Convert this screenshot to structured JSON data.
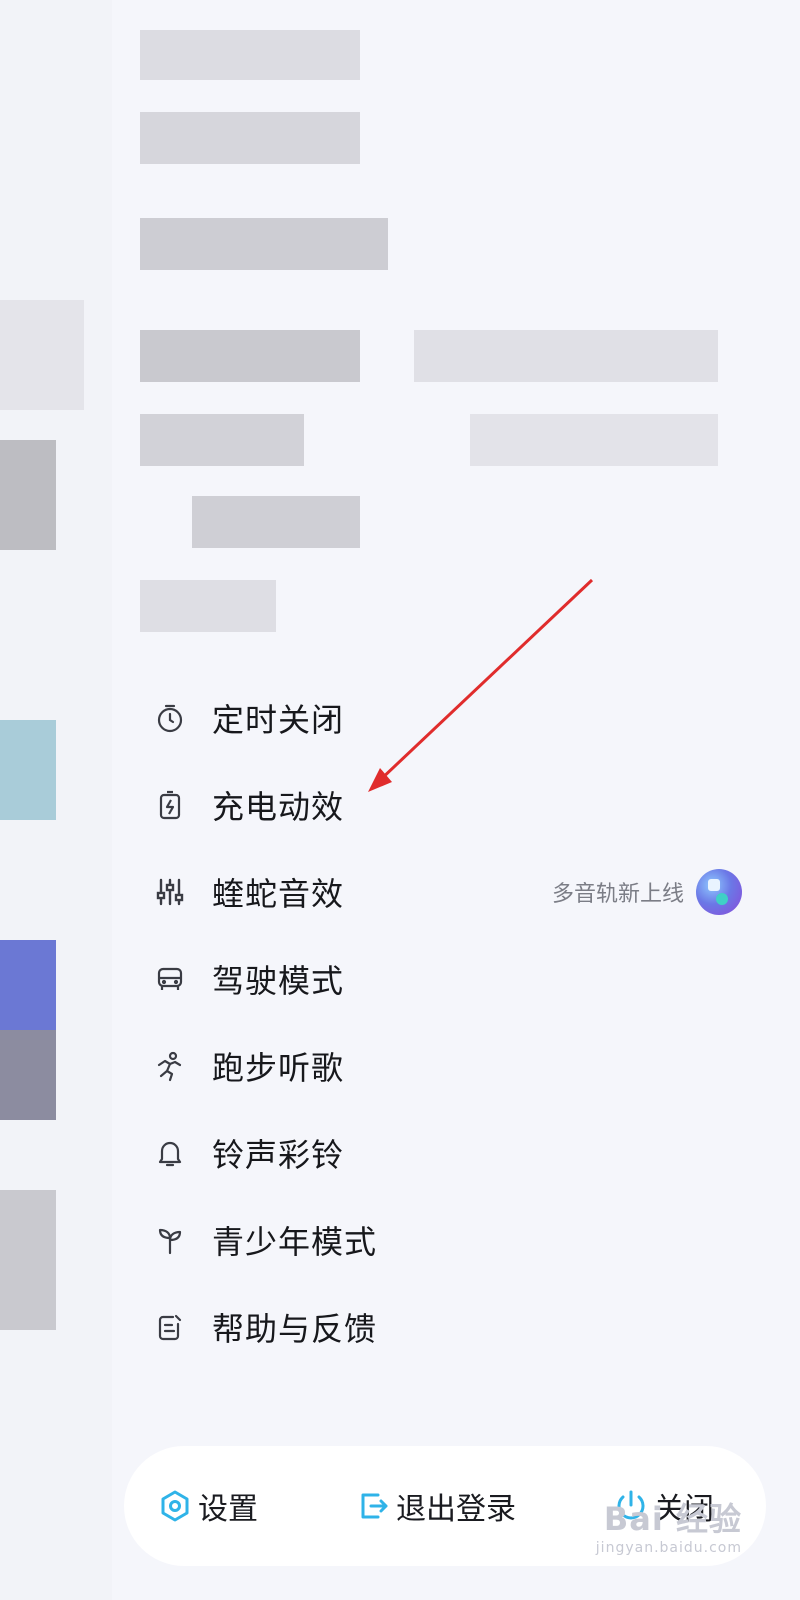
{
  "menu": {
    "items": [
      {
        "label": "定时关闭",
        "icon": "timer-icon"
      },
      {
        "label": "充电动效",
        "icon": "charging-battery-icon"
      },
      {
        "label": "蝰蛇音效",
        "icon": "equalizer-sliders-icon",
        "note": "多音轨新上线"
      },
      {
        "label": "驾驶模式",
        "icon": "car-icon"
      },
      {
        "label": "跑步听歌",
        "icon": "running-person-icon"
      },
      {
        "label": "铃声彩铃",
        "icon": "bell-icon"
      },
      {
        "label": "青少年模式",
        "icon": "sprout-icon"
      },
      {
        "label": "帮助与反馈",
        "icon": "feedback-edit-icon"
      }
    ]
  },
  "bottom_bar": {
    "settings_label": "设置",
    "logout_label": "退出登录",
    "close_label": "关闭"
  },
  "colors": {
    "accent": "#2fb3e8",
    "arrow": "#e02c2c"
  },
  "watermark": {
    "line1": "Bai 经验",
    "line2": "jingyan.baidu.com"
  }
}
